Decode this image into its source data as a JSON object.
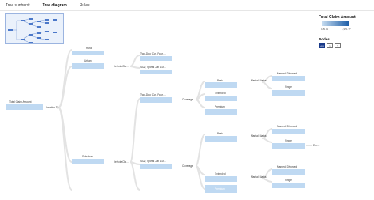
{
  "tabs": [
    {
      "label": "Tree sunburst",
      "active": false
    },
    {
      "label": "Tree diagram",
      "active": true
    },
    {
      "label": "Rules",
      "active": false
    }
  ],
  "legend": {
    "title": "Total Claim Amount",
    "min_label": "189.01",
    "max_label": "1,951.77",
    "color_low": "#c6dcf0",
    "color_high": "#1f5fa8"
  },
  "nodes_control": {
    "title": "Nodes",
    "options": [
      "All",
      "1",
      "2"
    ],
    "selected": "All"
  },
  "tree": {
    "nodes": [
      {
        "id": "root",
        "label": "Total Claim Amount",
        "color": "#a7cbee"
      },
      {
        "id": "split1",
        "label": "Location Ty..."
      },
      {
        "id": "rural",
        "label": "Rural",
        "color": "#dce9f7"
      },
      {
        "id": "urban",
        "label": "Urban",
        "color": "#a9cdf0"
      },
      {
        "id": "suburban",
        "label": "Suburban",
        "color": "#74ade4"
      },
      {
        "id": "vc_urban",
        "label": "Vehicle Cla..."
      },
      {
        "id": "vc_sub",
        "label": "Vehicle Cla..."
      },
      {
        "id": "u_two_door",
        "label": "Two-Door Car, Four-...",
        "color": "#dce9f7"
      },
      {
        "id": "u_suv",
        "label": "SUV, Sports Car, Lux...",
        "color": "#cfe2f5"
      },
      {
        "id": "s_two_door",
        "label": "Two-Door Car, Four-...",
        "color": "#d3e5f6"
      },
      {
        "id": "s_suv",
        "label": "SUV, Sports Car, Lux...",
        "color": "#5196dd"
      },
      {
        "id": "cov1",
        "label": "Coverage"
      },
      {
        "id": "cov2",
        "label": "Coverage"
      },
      {
        "id": "basic1",
        "label": "Basic",
        "color": "#7eb4e6"
      },
      {
        "id": "ext1",
        "label": "Extended",
        "color": "#cfe2f5"
      },
      {
        "id": "prem1",
        "label": "Premium",
        "color": "#dce9f7"
      },
      {
        "id": "basic2",
        "label": "Basic",
        "color": "#6aa7e3"
      },
      {
        "id": "ext2",
        "label": "Extended",
        "color": "#6aa7e3"
      },
      {
        "id": "prem2",
        "label": "Premium",
        "color": "#1f5fa8"
      },
      {
        "id": "ms1",
        "label": "Marital Status"
      },
      {
        "id": "ms2",
        "label": "Marital Status"
      },
      {
        "id": "ms3",
        "label": "Marital Status"
      },
      {
        "id": "md1",
        "label": "Married, Divorced",
        "color": "#d3e5f6"
      },
      {
        "id": "single1",
        "label": "Single",
        "color": "#7eb4e6"
      },
      {
        "id": "md2",
        "label": "Married, Divorced",
        "color": "#6aa7e3"
      },
      {
        "id": "single2",
        "label": "Single",
        "color": "#4f93dc"
      },
      {
        "id": "md3",
        "label": "Married, Divorced",
        "color": "#6aa7e3"
      },
      {
        "id": "single3",
        "label": "Single",
        "color": "#1f5fa8"
      },
      {
        "id": "em",
        "label": "Em..."
      }
    ]
  }
}
